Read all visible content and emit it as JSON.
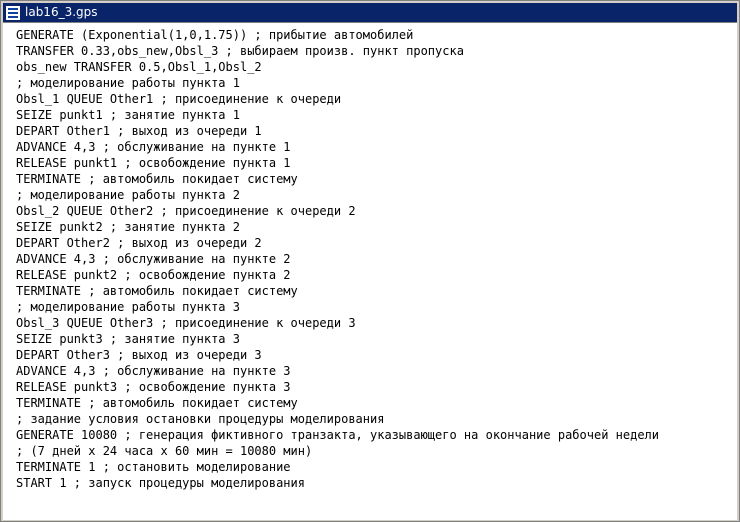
{
  "window": {
    "title": "lab16_3.gps",
    "title_icon": "document-icon"
  },
  "code_lines": [
    "GENERATE (Exponential(1,0,1.75)) ; прибытие автомобилей",
    "TRANSFER 0.33,obs_new,Obsl_3 ; выбираем произв. пункт пропуска",
    "obs_new TRANSFER 0.5,Obsl_1,Obsl_2",
    "; моделирование работы пункта 1",
    "Obsl_1 QUEUE Other1 ; присоединение к очереди",
    "SEIZE punkt1 ; занятие пункта 1",
    "DEPART Other1 ; выход из очереди 1",
    "ADVANCE 4,3 ; обслуживание на пункте 1",
    "RELEASE punkt1 ; освобождение пункта 1",
    "TERMINATE ; автомобиль покидает систему",
    "; моделирование работы пункта 2",
    "Obsl_2 QUEUE Other2 ; присоединение к очереди 2",
    "SEIZE punkt2 ; занятие пункта 2",
    "DEPART Other2 ; выход из очереди 2",
    "ADVANCE 4,3 ; обслуживание на пункте 2",
    "RELEASE punkt2 ; освобождение пункта 2",
    "TERMINATE ; автомобиль покидает систему",
    "; моделирование работы пункта 3",
    "Obsl_3 QUEUE Other3 ; присоединение к очереди 3",
    "SEIZE punkt3 ; занятие пункта 3",
    "DEPART Other3 ; выход из очереди 3",
    "ADVANCE 4,3 ; обслуживание на пункте 3",
    "RELEASE punkt3 ; освобождение пункта 3",
    "TERMINATE ; автомобиль покидает систему",
    "; задание условия остановки процедуры моделирования",
    "GENERATE 10080 ; генерация фиктивного транзакта, указывающего на окончание рабочей недели",
    "; (7 дней x 24 часа x 60 мин = 10080 мин)",
    "TERMINATE 1 ; остановить моделирование",
    "START 1 ; запуск процедуры моделирования"
  ]
}
